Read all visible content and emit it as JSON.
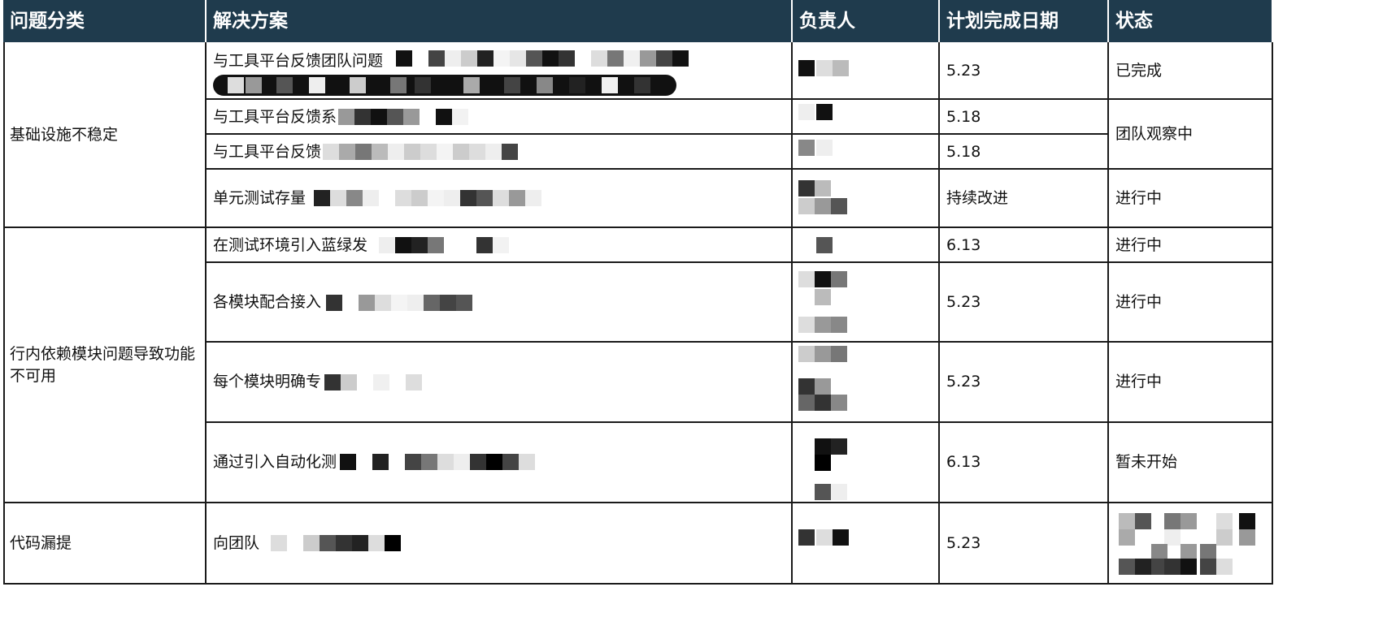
{
  "headers": [
    "问题分类",
    "解决方案",
    "负责人",
    "计划完成日期",
    "状态"
  ],
  "categories": {
    "infra": "基础设施不稳定",
    "deps": "行内依赖模块问题导致功能不可用",
    "leak": "代码漏提"
  },
  "solutions": [
    "与工具平台反馈团队问题",
    "与工具平台反馈系",
    "与工具平台反馈",
    "单元测试存量",
    "在测试环境引入蓝绿发",
    "各模块配合接入",
    "每个模块明确专",
    "通过引入自动化测",
    "向团队"
  ],
  "dates": [
    "5.23",
    "5.18",
    "5.18",
    "持续改进",
    "6.13",
    "5.23",
    "5.23",
    "6.13",
    "5.23"
  ],
  "statuses": {
    "r1": "已完成",
    "r23": "团队观察中",
    "r4": "进行中",
    "r5": "进行中",
    "r6": "进行中",
    "r7": "进行中",
    "r8": "暂未开始"
  },
  "colors": {
    "header_bg": "#1f3b4d",
    "header_text": "#ffffff",
    "grid": "#1a1a1a"
  }
}
